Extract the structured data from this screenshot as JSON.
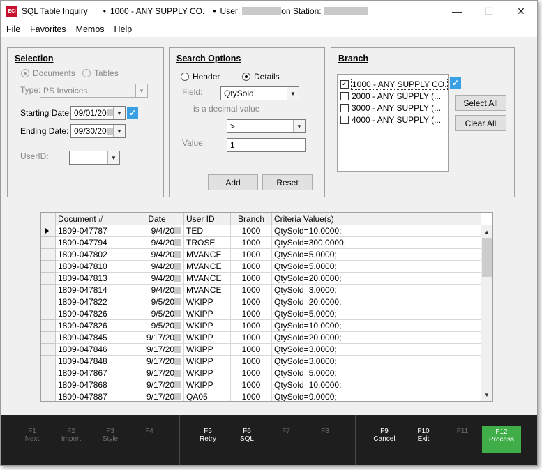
{
  "titlebar": {
    "logo": "ECI",
    "title": "SQL Table Inquiry",
    "bullet": "•",
    "company": "1000 - ANY SUPPLY CO.",
    "user_label": "User:",
    "station_label": "on Station:",
    "minimize": "—",
    "maximize": "☐",
    "close": "✕"
  },
  "menu": [
    "File",
    "Favorites",
    "Memos",
    "Help"
  ],
  "selection": {
    "title": "Selection",
    "documents_label": "Documents",
    "tables_label": "Tables",
    "selected": "Documents",
    "type_label": "Type:",
    "type_value": "PS Invoices",
    "starting_date_label": "Starting Date:",
    "starting_date": "09/01/20",
    "ending_date_label": "Ending Date:",
    "ending_date": "09/30/20",
    "userid_label": "UserID:",
    "userid_value": ""
  },
  "search_options": {
    "title": "Search Options",
    "header_label": "Header",
    "details_label": "Details",
    "selected": "Details",
    "field_label": "Field:",
    "field_value": "QtySold",
    "field_note": "is a decimal value",
    "operator": ">",
    "value_label": "Value:",
    "value": "1",
    "add_label": "Add",
    "reset_label": "Reset"
  },
  "branch": {
    "title": "Branch",
    "items": [
      {
        "label": "1000 - ANY SUPPLY CO.",
        "checked": true
      },
      {
        "label": "2000 - ANY SUPPLY (...",
        "checked": false
      },
      {
        "label": "3000 - ANY SUPPLY (...",
        "checked": false
      },
      {
        "label": "4000 - ANY SUPPLY (...",
        "checked": false
      }
    ],
    "select_all_label": "Select All",
    "clear_all_label": "Clear All"
  },
  "grid": {
    "columns": [
      "Document #",
      "Date",
      "User ID",
      "Branch",
      "Criteria Value(s)"
    ],
    "rows": [
      {
        "doc": "1809-047787",
        "date": "9/4/20",
        "user": "TED",
        "branch": "1000",
        "criteria": "QtySold=10.0000;"
      },
      {
        "doc": "1809-047794",
        "date": "9/4/20",
        "user": "TROSE",
        "branch": "1000",
        "criteria": "QtySold=300.0000;"
      },
      {
        "doc": "1809-047802",
        "date": "9/4/20",
        "user": "MVANCE",
        "branch": "1000",
        "criteria": "QtySold=5.0000;"
      },
      {
        "doc": "1809-047810",
        "date": "9/4/20",
        "user": "MVANCE",
        "branch": "1000",
        "criteria": "QtySold=5.0000;"
      },
      {
        "doc": "1809-047813",
        "date": "9/4/20",
        "user": "MVANCE",
        "branch": "1000",
        "criteria": "QtySold=20.0000;"
      },
      {
        "doc": "1809-047814",
        "date": "9/4/20",
        "user": "MVANCE",
        "branch": "1000",
        "criteria": "QtySold=3.0000;"
      },
      {
        "doc": "1809-047822",
        "date": "9/5/20",
        "user": "WKIPP",
        "branch": "1000",
        "criteria": "QtySold=20.0000;"
      },
      {
        "doc": "1809-047826",
        "date": "9/5/20",
        "user": "WKIPP",
        "branch": "1000",
        "criteria": "QtySold=5.0000;"
      },
      {
        "doc": "1809-047826",
        "date": "9/5/20",
        "user": "WKIPP",
        "branch": "1000",
        "criteria": "QtySold=10.0000;"
      },
      {
        "doc": "1809-047845",
        "date": "9/17/20",
        "user": "WKIPP",
        "branch": "1000",
        "criteria": "QtySold=20.0000;"
      },
      {
        "doc": "1809-047846",
        "date": "9/17/20",
        "user": "WKIPP",
        "branch": "1000",
        "criteria": "QtySold=3.0000;"
      },
      {
        "doc": "1809-047848",
        "date": "9/17/20",
        "user": "WKIPP",
        "branch": "1000",
        "criteria": "QtySold=3.0000;"
      },
      {
        "doc": "1809-047867",
        "date": "9/17/20",
        "user": "WKIPP",
        "branch": "1000",
        "criteria": "QtySold=5.0000;"
      },
      {
        "doc": "1809-047868",
        "date": "9/17/20",
        "user": "WKIPP",
        "branch": "1000",
        "criteria": "QtySold=10.0000;"
      },
      {
        "doc": "1809-047887",
        "date": "9/17/20",
        "user": "QA05",
        "branch": "1000",
        "criteria": "QtySold=9.0000;"
      }
    ]
  },
  "function_keys": [
    {
      "key": "F1",
      "label": "Next",
      "enabled": false
    },
    {
      "key": "F2",
      "label": "Import",
      "enabled": false
    },
    {
      "key": "F3",
      "label": "Style",
      "enabled": false
    },
    {
      "key": "F4",
      "label": "",
      "enabled": false
    },
    {
      "key": "F5",
      "label": "Retry",
      "enabled": true
    },
    {
      "key": "F6",
      "label": "SQL",
      "enabled": true
    },
    {
      "key": "F7",
      "label": "",
      "enabled": false
    },
    {
      "key": "F8",
      "label": "",
      "enabled": false
    },
    {
      "key": "F9",
      "label": "Cancel",
      "enabled": true
    },
    {
      "key": "F10",
      "label": "Exit",
      "enabled": true
    },
    {
      "key": "F11",
      "label": "",
      "enabled": false
    },
    {
      "key": "F12",
      "label": "Process",
      "enabled": true
    }
  ],
  "colors": {
    "accent_check": "#3aa0e6",
    "process_button": "#3fae49",
    "fbar_background": "#1e1e1e",
    "logo_red": "#c8102e"
  },
  "icons": {
    "app": "eci-logo-icon",
    "dropdown": "chevron-down-icon",
    "check": "checkmark-icon",
    "row_pointer": "row-pointer-icon"
  }
}
